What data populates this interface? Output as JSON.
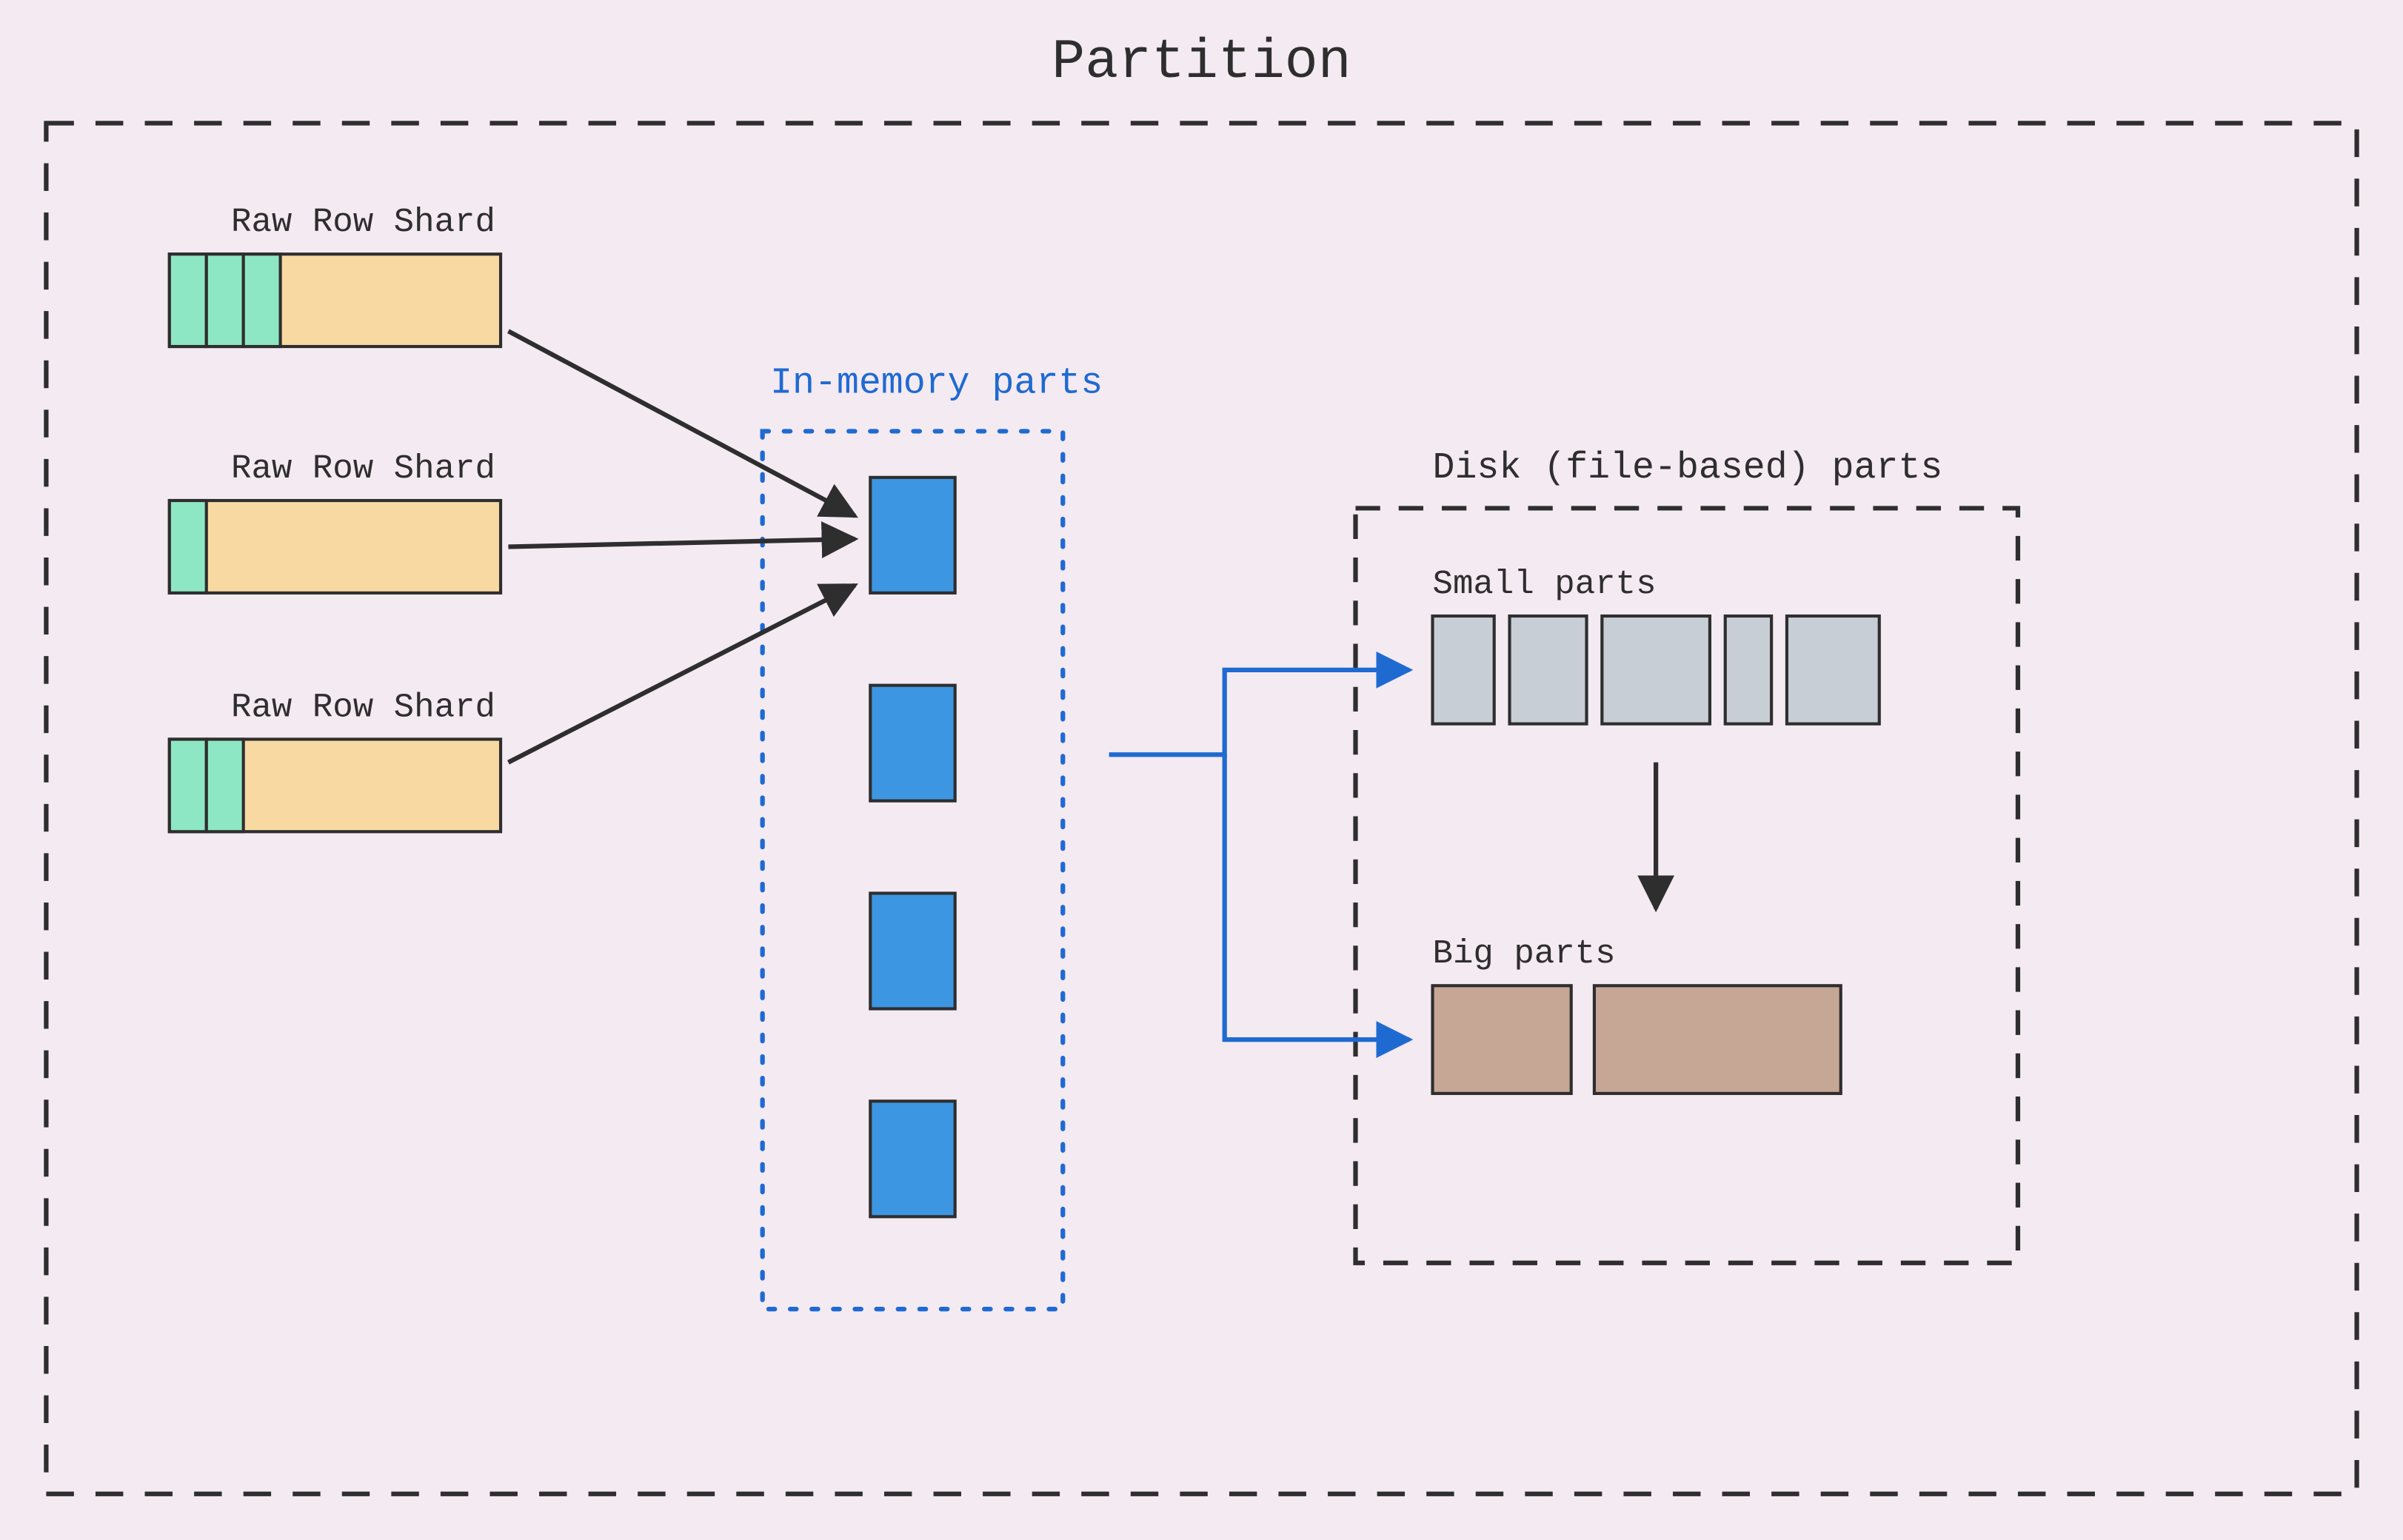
{
  "title": "Partition",
  "shards": [
    {
      "label": "Raw Row Shard",
      "green_cells": 3
    },
    {
      "label": "Raw Row Shard",
      "green_cells": 1
    },
    {
      "label": "Raw Row Shard",
      "green_cells": 2
    }
  ],
  "in_memory": {
    "label": "In-memory parts",
    "count": 4
  },
  "disk": {
    "label": "Disk (file-based) parts",
    "small": {
      "label": "Small parts",
      "widths": [
        40,
        50,
        70,
        30,
        60
      ]
    },
    "big": {
      "label": "Big parts",
      "widths": [
        90,
        160
      ]
    }
  },
  "colors": {
    "bg": "#f4eaf2",
    "green": "#8ee7c4",
    "orange": "#f8d9a2",
    "blue_fill": "#3d96e1",
    "blue_stroke": "#1f6ad1",
    "grey_fill": "#c8ced6",
    "brown_fill": "#c6a694",
    "stroke": "#2e2e2e"
  }
}
